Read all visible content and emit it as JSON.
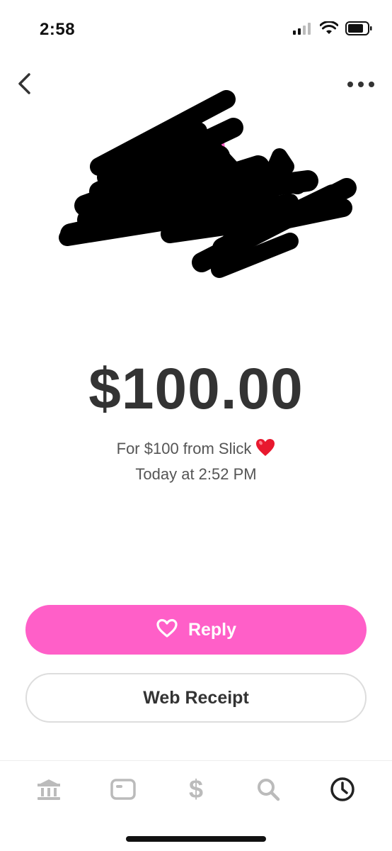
{
  "status_bar": {
    "time": "2:58"
  },
  "header": {
    "back_icon": "chevron-left-icon",
    "more_icon": "ellipsis-icon"
  },
  "payment": {
    "amount": "$100.00",
    "note": "For $100 from Slick",
    "note_emoji": "heart-emoji",
    "timestamp": "Today at 2:52 PM"
  },
  "actions": {
    "reply_label": "Reply",
    "web_receipt_label": "Web Receipt"
  },
  "tab_bar": {
    "tabs": [
      {
        "icon": "bank-icon",
        "active": false
      },
      {
        "icon": "card-icon",
        "active": false
      },
      {
        "icon": "dollar-icon",
        "active": false
      },
      {
        "icon": "search-icon",
        "active": false
      },
      {
        "icon": "clock-icon",
        "active": true
      }
    ]
  },
  "colors": {
    "accent_pink": "#FF5FC8",
    "text_primary": "#333333",
    "text_secondary": "#555555",
    "tab_inactive": "#bbbbbb",
    "tab_active": "#222222"
  }
}
